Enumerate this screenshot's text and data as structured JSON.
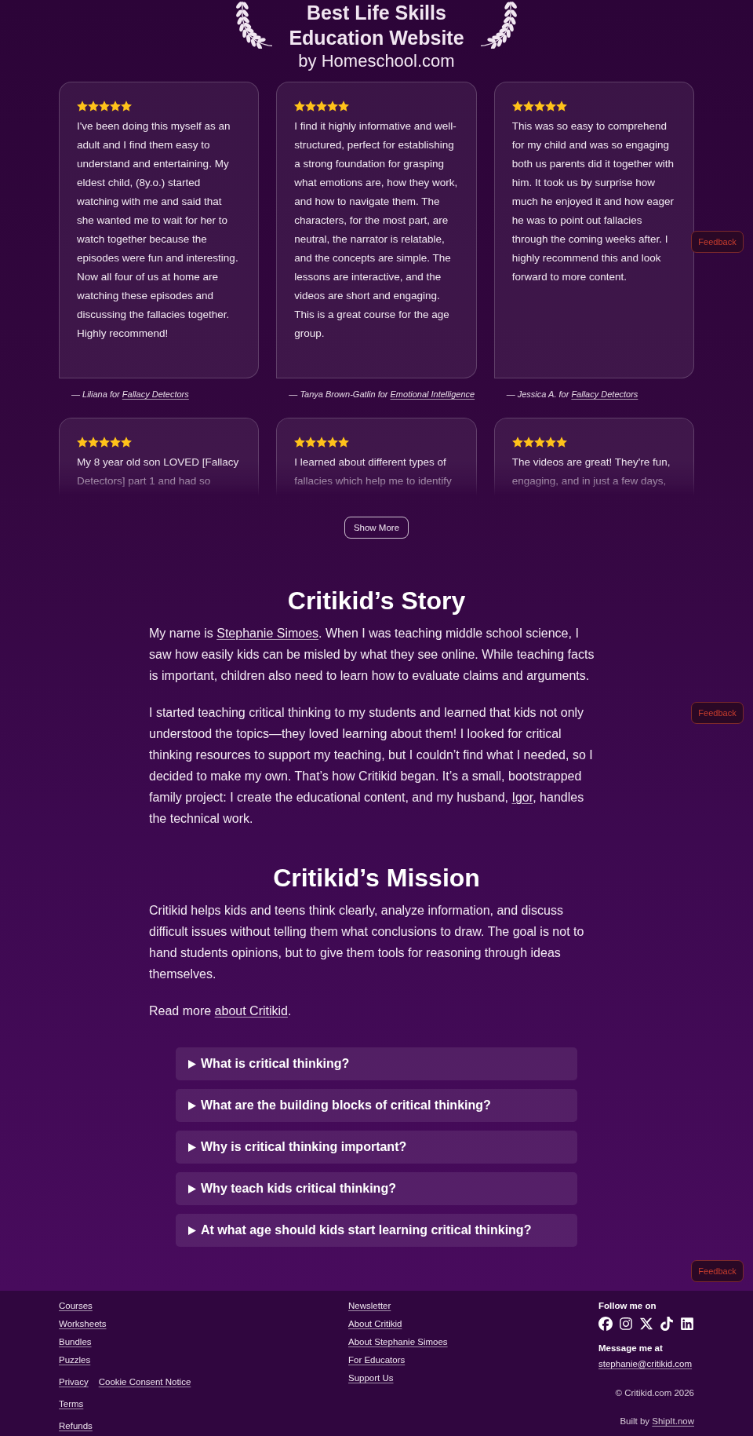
{
  "award": {
    "title_lines": [
      "Best Life Skills",
      "Education Website"
    ],
    "subtitle": "by Homeschool.com"
  },
  "reviews": [
    {
      "stars": 5,
      "text": "I've been doing this myself as an adult and I find them easy to understand and entertaining. My eldest child, (8y.o.) started watching with me and said that she wanted me to wait for her to watch together because the episodes were fun and interesting. Now all four of us at home are watching these episodes and discussing the fallacies together. Highly recommend!",
      "attribution": [
        {
          "kind": "text",
          "value": "— Liliana for "
        },
        {
          "kind": "link",
          "value": "Fallacy Detectors"
        }
      ]
    },
    {
      "stars": 5,
      "text": "I find it highly informative and well-structured, perfect for establishing a strong foundation for grasping what emotions are, how they work, and how to navigate them. The characters, for the most part, are neutral, the narrator is relatable, and the concepts are simple. The lessons are interactive, and the videos are short and engaging. This is a great course for the age group.",
      "attribution": [
        {
          "kind": "text",
          "value": "— Tanya Brown-Gatlin for "
        },
        {
          "kind": "link",
          "value": "Emotional Intelligence"
        }
      ]
    },
    {
      "stars": 5,
      "text": "This was so easy to comprehend for my child and was so engaging both us parents did it together with him. It took us by surprise how much he enjoyed it and how eager he was to point out fallacies through the coming weeks after. I highly recommend this and look forward to more content.",
      "attribution": [
        {
          "kind": "text",
          "value": "— Jessica A. for "
        },
        {
          "kind": "link",
          "value": "Fallacy Detectors"
        }
      ]
    }
  ],
  "more_reviews": [
    {
      "stars": 5,
      "text": "My 8 year old son LOVED [Fallacy Detectors] part 1 and had so"
    },
    {
      "stars": 5,
      "text": "I learned about different types of fallacies which help me to identify"
    },
    {
      "stars": 5,
      "text": "The videos are great! They're fun, engaging, and in just a few days,"
    }
  ],
  "show_more_button": "Show More",
  "story": {
    "heading": "Critikid’s Story",
    "paragraphs": [
      [
        {
          "kind": "text",
          "value": "My name is "
        },
        {
          "kind": "link",
          "value": "Stephanie Simoes"
        },
        {
          "kind": "text",
          "value": ". When I was teaching middle school science, I saw how easily kids can be misled by what they see online. While teaching facts is important, children also need to learn how to evaluate claims and arguments."
        }
      ],
      [
        {
          "kind": "text",
          "value": "I started teaching critical thinking to my students and learned that kids not only understood the topics—they loved learning about them! I looked for critical thinking resources to support my teaching, but I couldn’t find what I needed, so I decided to make my own. That’s how Critikid began. It’s a small, bootstrapped family project: I create the educational content, and my husband, "
        },
        {
          "kind": "link",
          "value": "Igor"
        },
        {
          "kind": "text",
          "value": ", handles the technical work."
        }
      ]
    ]
  },
  "mission": {
    "heading": "Critikid’s Mission",
    "paragraphs": [
      [
        {
          "kind": "text",
          "value": "Critikid helps kids and teens think clearly, analyze information, and discuss difficult issues without telling them what conclusions to draw. The goal is not to hand students opinions, but to give them tools for reasoning through ideas themselves."
        }
      ],
      [
        {
          "kind": "text",
          "value": "Read more "
        },
        {
          "kind": "link",
          "value": "about Critikid"
        },
        {
          "kind": "text",
          "value": "."
        }
      ]
    ]
  },
  "faq": [
    {
      "question": "What is critical thinking?",
      "expanded": false
    },
    {
      "question": "What are the building blocks of critical thinking?",
      "expanded": false
    },
    {
      "question": "Why is critical thinking important?",
      "expanded": false
    },
    {
      "question": "Why teach kids critical thinking?",
      "expanded": false
    },
    {
      "question": "At what age should kids start learning critical thinking?",
      "expanded": false
    }
  ],
  "feedback_buttons": [
    "Feedback",
    "Feedback",
    "Feedback"
  ],
  "footer": {
    "nav_links": [
      "Courses",
      "Worksheets",
      "Bundles",
      "Puzzles"
    ],
    "legal_rows": [
      [
        "Privacy",
        "Cookie Consent Notice"
      ],
      [
        "Terms"
      ],
      [
        "Refunds"
      ]
    ],
    "info_links": [
      "Newsletter",
      "About Critikid",
      "About Stephanie Simoes",
      "For Educators",
      "Support Us"
    ],
    "follow_heading": "Follow me on",
    "message_heading": "Message me at",
    "email": "stephanie@critikid.com",
    "copyright": "© Critikid.com 2026",
    "built_by": [
      {
        "kind": "text",
        "value": "Built by "
      },
      {
        "kind": "link",
        "value": "ShipIt.now"
      }
    ]
  }
}
